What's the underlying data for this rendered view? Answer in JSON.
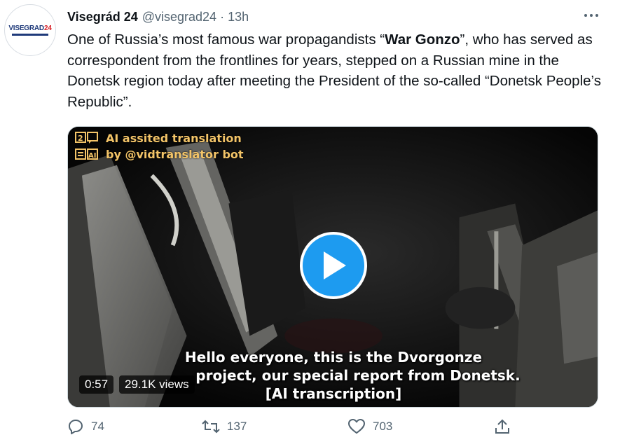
{
  "account": {
    "name": "Visegrád 24",
    "handle": "@visegrad24",
    "separator": "·",
    "time": "13h",
    "avatar_text": "VISEGRAD",
    "avatar_number": "24"
  },
  "tweet": {
    "text_part1": "One of Russia’s most famous war propagandists “",
    "text_bold": "War Gonzo",
    "text_part2": "”, who has served as correspondent from the frontlines for years, stepped on a Russian mine in the Donetsk region today after meeting the President of the so-called “Donetsk People’s Republic”."
  },
  "video": {
    "badge_line1": "AI assited translation",
    "badge_line2": "by @vidtranslator bot",
    "subtitle_line1": "Hello everyone, this is the Dvorgonze",
    "subtitle_line2": "project, our special report from Donetsk.",
    "subtitle_line3": "[AI transcription]",
    "duration": "0:57",
    "views": "29.1K views"
  },
  "actions": {
    "replies": "74",
    "retweets": "137",
    "likes": "703"
  },
  "colors": {
    "accent": "#1d9bf0",
    "muted": "#536471",
    "text": "#0f1419",
    "badge": "#f3c468"
  },
  "icons": {
    "more": "more-horizontal-icon",
    "reply": "reply-icon",
    "retweet": "retweet-icon",
    "like": "heart-icon",
    "share": "share-icon",
    "play": "play-icon"
  }
}
